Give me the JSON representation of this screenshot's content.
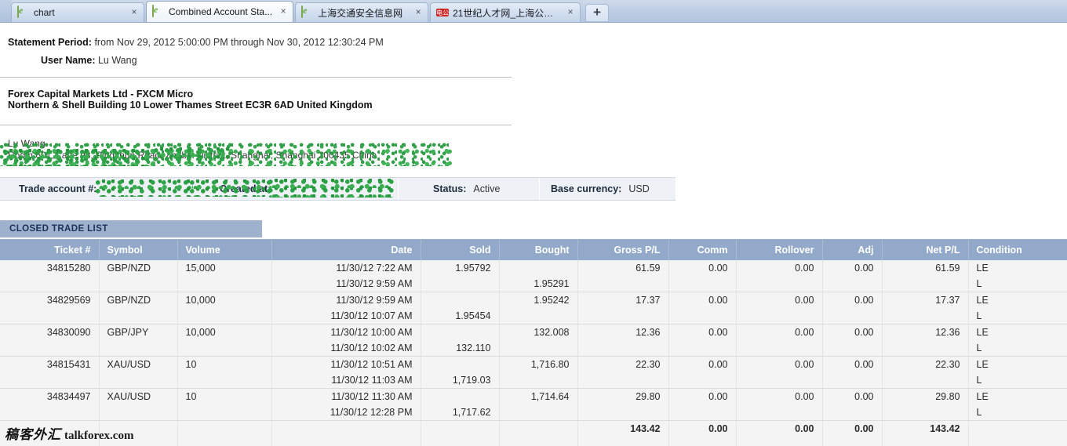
{
  "browser": {
    "tabs": [
      {
        "title": "chart",
        "favicon": "document-green-icon",
        "active": false,
        "close_label": "×"
      },
      {
        "title": "Combined Account Sta...",
        "favicon": "document-green-icon",
        "active": true,
        "close_label": "×"
      },
      {
        "title": "上海交通安全信息网",
        "favicon": "document-green-icon",
        "active": false,
        "close_label": "×"
      },
      {
        "title": "21世纪人才网_上海公务...",
        "favicon": "red-seal-icon",
        "active": false,
        "close_label": "×"
      }
    ],
    "new_tab_label": "+"
  },
  "statement": {
    "period_label": "Statement Period:",
    "period_value": "from Nov 29, 2012 5:00:00 PM through Nov 30, 2012 12:30:24 PM",
    "user_label": "User Name:",
    "user_value": "Lu Wang",
    "firm_line1": "Forex Capital Markets Ltd - FXCM Micro",
    "firm_line2": "Northern & Shell Building 10 Lower Thames Street EC3R 6AD United Kingdom",
    "address_line1": "Lu Wang",
    "address_line2": "Room 601, Lane 98, Pingshun Road, Zhabei District, Shanghai, Shanghai 200435 China"
  },
  "account_bar": {
    "trade_account_label": "Trade account #:",
    "trade_account_value": "",
    "created_at_label": "Created at:",
    "created_at_value": "",
    "status_label": "Status:",
    "status_value": "Active",
    "base_currency_label": "Base currency:",
    "base_currency_value": "USD"
  },
  "section": {
    "closed_trade_list_title": "CLOSED TRADE LIST"
  },
  "table": {
    "columns": [
      {
        "label": "Ticket #",
        "align": "r"
      },
      {
        "label": "Symbol",
        "align": "l"
      },
      {
        "label": "Volume",
        "align": "l"
      },
      {
        "label": "Date",
        "align": "r"
      },
      {
        "label": "Sold",
        "align": "r"
      },
      {
        "label": "Bought",
        "align": "r"
      },
      {
        "label": "Gross P/L",
        "align": "r"
      },
      {
        "label": "Comm",
        "align": "r"
      },
      {
        "label": "Rollover",
        "align": "r"
      },
      {
        "label": "Adj",
        "align": "r"
      },
      {
        "label": "Net P/L",
        "align": "r"
      },
      {
        "label": "Condition",
        "align": "l"
      }
    ],
    "rows": [
      {
        "ticket": "34815280",
        "symbol": "GBP/NZD",
        "volume": "15,000",
        "date_open": "11/30/12 7:22 AM",
        "date_close": "11/30/12 9:59 AM",
        "sold_top": "1.95792",
        "sold_bottom": "",
        "bought_top": "",
        "bought_bottom": "1.95291",
        "gross_pl": "61.59",
        "comm": "0.00",
        "rollover": "0.00",
        "adj": "0.00",
        "net_pl": "61.59",
        "condition_top": "LE",
        "condition_bottom": "L"
      },
      {
        "ticket": "34829569",
        "symbol": "GBP/NZD",
        "volume": "10,000",
        "date_open": "11/30/12 9:59 AM",
        "date_close": "11/30/12 10:07 AM",
        "sold_top": "",
        "sold_bottom": "1.95454",
        "bought_top": "1.95242",
        "bought_bottom": "",
        "gross_pl": "17.37",
        "comm": "0.00",
        "rollover": "0.00",
        "adj": "0.00",
        "net_pl": "17.37",
        "condition_top": "LE",
        "condition_bottom": "L"
      },
      {
        "ticket": "34830090",
        "symbol": "GBP/JPY",
        "volume": "10,000",
        "date_open": "11/30/12 10:00 AM",
        "date_close": "11/30/12 10:02 AM",
        "sold_top": "",
        "sold_bottom": "132.110",
        "bought_top": "132.008",
        "bought_bottom": "",
        "gross_pl": "12.36",
        "comm": "0.00",
        "rollover": "0.00",
        "adj": "0.00",
        "net_pl": "12.36",
        "condition_top": "LE",
        "condition_bottom": "L"
      },
      {
        "ticket": "34815431",
        "symbol": "XAU/USD",
        "volume": "10",
        "date_open": "11/30/12 10:51 AM",
        "date_close": "11/30/12 11:03 AM",
        "sold_top": "",
        "sold_bottom": "1,719.03",
        "bought_top": "1,716.80",
        "bought_bottom": "",
        "gross_pl": "22.30",
        "comm": "0.00",
        "rollover": "0.00",
        "adj": "0.00",
        "net_pl": "22.30",
        "condition_top": "LE",
        "condition_bottom": "L"
      },
      {
        "ticket": "34834497",
        "symbol": "XAU/USD",
        "volume": "10",
        "date_open": "11/30/12 11:30 AM",
        "date_close": "11/30/12 12:28 PM",
        "sold_top": "",
        "sold_bottom": "1,717.62",
        "bought_top": "1,714.64",
        "bought_bottom": "",
        "gross_pl": "29.80",
        "comm": "0.00",
        "rollover": "0.00",
        "adj": "0.00",
        "net_pl": "29.80",
        "condition_top": "LE",
        "condition_bottom": "L"
      }
    ],
    "totals": {
      "gross_pl": "143.42",
      "comm": "0.00",
      "rollover": "0.00",
      "adj": "0.00",
      "net_pl": "143.42"
    }
  },
  "watermark": {
    "cn": "稿客外汇",
    "en": "talkforex.com"
  },
  "colors": {
    "tab_strip": "#bccde3",
    "table_header": "#92a9c9",
    "section_title": "#9fb2cd",
    "row_bg": "#f4f4f4",
    "totals_bg": "#e4e4e4",
    "redaction": "#2fa148"
  }
}
